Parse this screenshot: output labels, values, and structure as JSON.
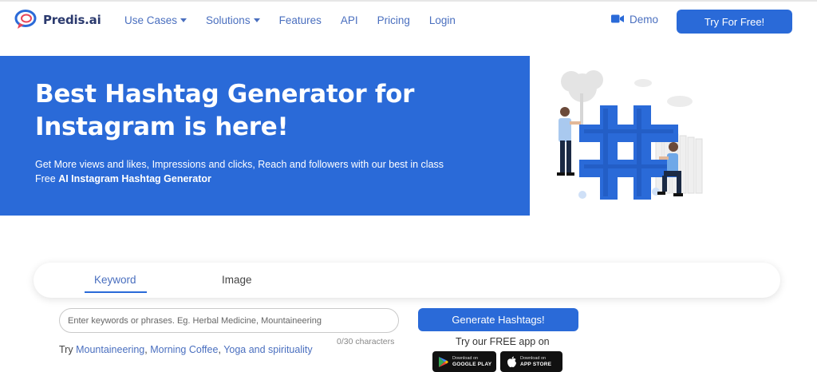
{
  "brand": {
    "name": "Predis.ai",
    "accent": "#2a6ad8",
    "link_color": "#4a6fbf"
  },
  "nav": {
    "items": [
      {
        "label": "Use Cases",
        "dropdown": true
      },
      {
        "label": "Solutions",
        "dropdown": true
      },
      {
        "label": "Features",
        "dropdown": false
      },
      {
        "label": "API",
        "dropdown": false
      },
      {
        "label": "Pricing",
        "dropdown": false
      },
      {
        "label": "Login",
        "dropdown": false
      }
    ],
    "demo_label": "Demo",
    "demo_icon": "video-camera-icon",
    "cta_label": "Try For Free!"
  },
  "hero": {
    "title": "Best Hashtag Generator for Instagram is here!",
    "subtitle_line1": "Get More views and likes, Impressions and clicks, Reach and followers with our best in class",
    "subtitle_prefix": "Free ",
    "subtitle_bold": "AI Instagram Hashtag Generator",
    "illustration": "hashtag-illustration"
  },
  "tabs": [
    {
      "label": "Keyword",
      "active": true
    },
    {
      "label": "Image",
      "active": false
    }
  ],
  "form": {
    "placeholder": "Enter keywords or phrases. Eg. Herbal Medicine, Mountaineering",
    "value": "",
    "counter": "0/30 characters",
    "try_label": "Try",
    "suggestions": [
      "Mountaineering",
      "Morning Coffee",
      "Yoga and spirituality"
    ],
    "generate_label": "Generate Hashtags!"
  },
  "app": {
    "label": "Try our FREE app on",
    "google_small": "Download on",
    "google_big": "GOOGLE PLAY",
    "apple_small": "Download on",
    "apple_big": "APP STORE"
  }
}
